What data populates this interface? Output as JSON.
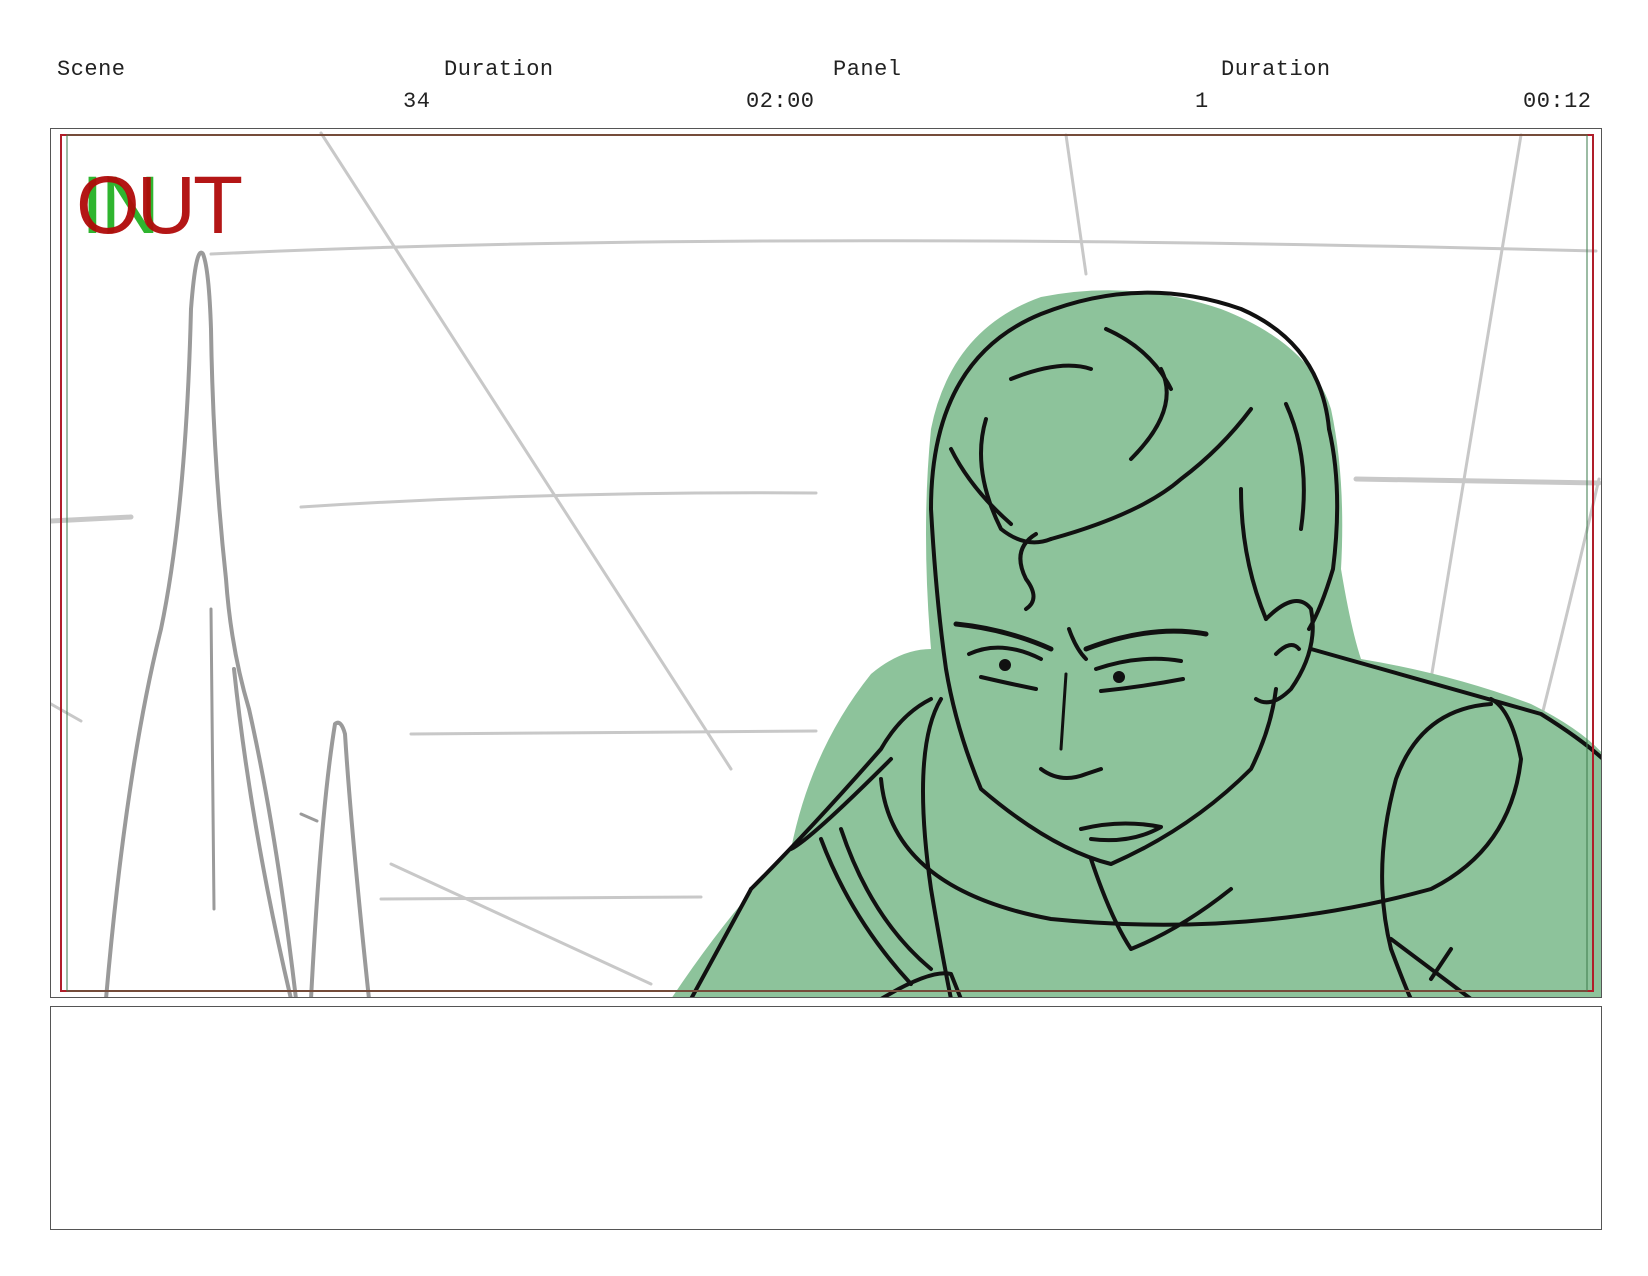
{
  "header": {
    "scene_label": "Scene",
    "scene_duration_label": "Duration",
    "panel_label": "Panel",
    "panel_duration_label": "Duration",
    "scene_number": "34",
    "scene_duration": "02:00",
    "panel_number": "1",
    "panel_duration": "00:12"
  },
  "panel": {
    "in_marker": "IN",
    "out_marker": "OUT",
    "colors": {
      "character_fill": "#8dc39b",
      "line_art": "#111111",
      "background_sketch": "#c8c8c8",
      "rock_sketch": "#9a9a9a",
      "safe_frame": "#b01e2a",
      "in_marker": "#2fb52f",
      "out_marker": "#b00a0a"
    }
  },
  "notes": {
    "text": ""
  }
}
